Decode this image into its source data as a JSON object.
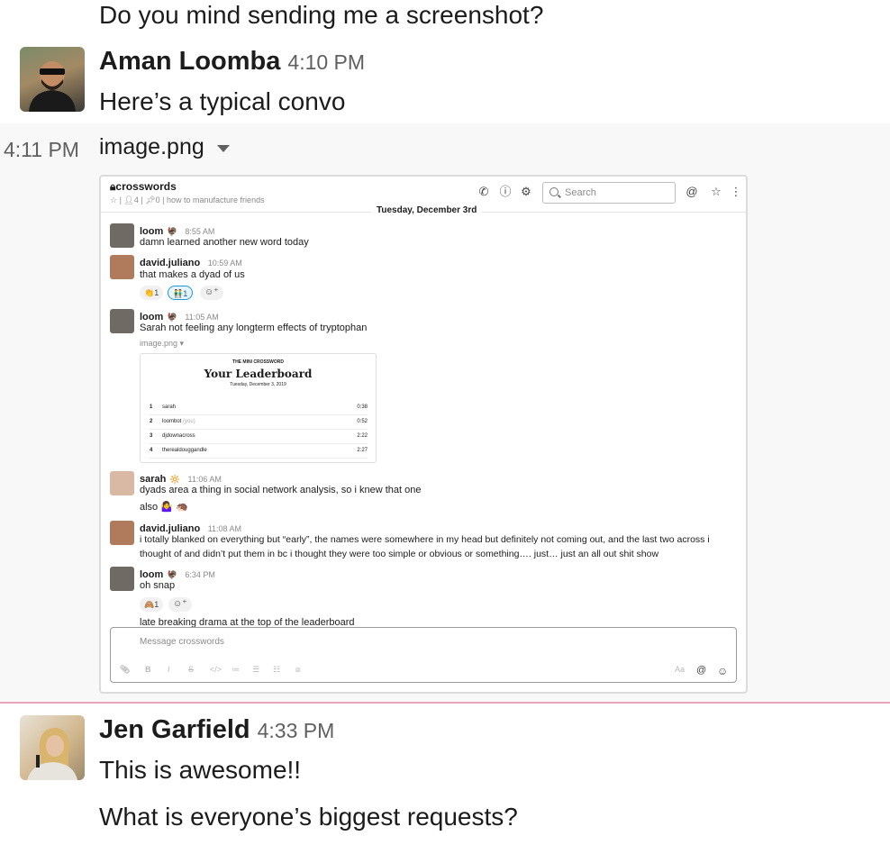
{
  "top_message": {
    "text": "Do you mind sending me a screenshot?"
  },
  "aman": {
    "name": "Aman Loomba",
    "time": "4:10 PM",
    "text": "Here’s a typical convo",
    "side_time": "4:11 PM",
    "file_name": "image.png"
  },
  "screenshot": {
    "channel": "crosswords",
    "members": "4",
    "pins": "0",
    "topic": "how to manufacture friends",
    "search_placeholder": "Search",
    "date_divider": "Tuesday, December 3rd",
    "messages": [
      {
        "name": "loom",
        "emoji": "🦃",
        "time": "8:55 AM",
        "text": "damn learned another new word today"
      },
      {
        "name": "david.juliano",
        "time": "10:59 AM",
        "text": "that makes a dyad of us"
      },
      {
        "name": "loom",
        "emoji": "🦃",
        "time": "11:05 AM",
        "text": "Sarah not feeling any longterm effects of tryptophan",
        "file": "image.png"
      },
      {
        "name": "sarah",
        "emoji": "🔆",
        "time": "11:06 AM",
        "text": "dyads area a thing in social network analysis, so i knew that one",
        "text2": "also 🤷‍♀️ 🦔"
      },
      {
        "name": "david.juliano",
        "time": "11:08 AM",
        "text": "i totally blanked on everything but “early”, the names were somewhere in my head but definitely not coming out, and the last two across i",
        "text2": "thought of and didn’t put them in bc i thought they were too simple or obvious or something…. just… just an all out shit show"
      },
      {
        "name": "loom",
        "emoji": "🦃",
        "time": "6:34 PM",
        "text": "oh snap",
        "text2": "late breaking drama at the top of the leaderboard"
      }
    ],
    "reactions_1": [
      {
        "emoji": "👏",
        "count": "1"
      },
      {
        "emoji": "👬",
        "count": "1"
      }
    ],
    "reactions_2": [
      {
        "emoji": "🙈",
        "count": "1"
      }
    ],
    "leaderboard": {
      "kicker": "THE MINI CROSSWORD",
      "title": "Your Leaderboard",
      "date": "Tuesday, December 3, 2019",
      "rows": [
        {
          "rank": "1",
          "name": "sarah",
          "tag": "",
          "time": "0:38"
        },
        {
          "rank": "2",
          "name": "loombot",
          "tag": "(you)",
          "time": "0:52"
        },
        {
          "rank": "3",
          "name": "djdownacross",
          "tag": "",
          "time": "2:22"
        },
        {
          "rank": "4",
          "name": "therealdouggandle",
          "tag": "",
          "time": "2:27"
        }
      ]
    },
    "composer_placeholder": "Message crosswords"
  },
  "jen": {
    "name": "Jen Garfield",
    "time": "4:33 PM",
    "text1": "This is awesome!!",
    "text2": "What is everyone’s biggest requests?"
  },
  "colors": {
    "new_line": "#e8a6b8",
    "hover_bg": "#f8f8f8",
    "link_blue": "#1264a3"
  }
}
